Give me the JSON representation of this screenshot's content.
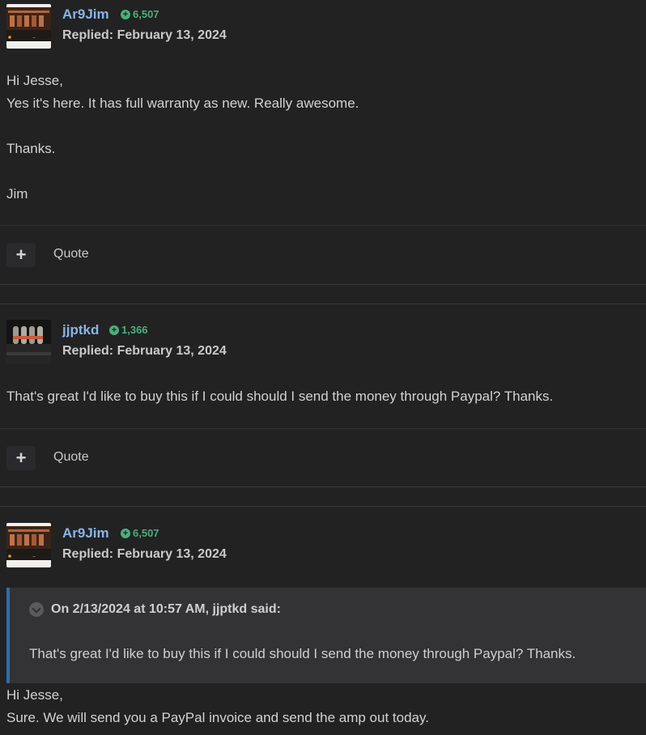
{
  "posts": [
    {
      "author": "Ar9Jim",
      "reputation": "6,507",
      "replied": "Replied: February 13, 2024",
      "lines": [
        "Hi Jesse,",
        "Yes it's here. It has full warranty as new.  Really awesome.",
        "",
        "Thanks.",
        "",
        "Jim"
      ],
      "quote_label": "Quote"
    },
    {
      "author": "jjptkd",
      "reputation": "1,366",
      "replied": "Replied: February 13, 2024",
      "lines": [
        "That's great I'd like to buy this if I could should I send the money through Paypal? Thanks."
      ],
      "quote_label": "Quote"
    },
    {
      "author": "Ar9Jim",
      "reputation": "6,507",
      "replied": "Replied: February 13, 2024",
      "quoted": {
        "header": "On 2/13/2024 at 10:57 AM, jjptkd said:",
        "text": "That's great I'd like to buy this if I could should I send the money through Paypal? Thanks."
      },
      "lines": [
        "Hi Jesse,",
        "Sure. We will send you a PayPal invoice and send the amp out today."
      ]
    }
  ],
  "colors": {
    "background": "#222223",
    "author": "#8ab4e6",
    "reputation": "#4caf7a",
    "quote_bar": "#2f6ea8"
  }
}
